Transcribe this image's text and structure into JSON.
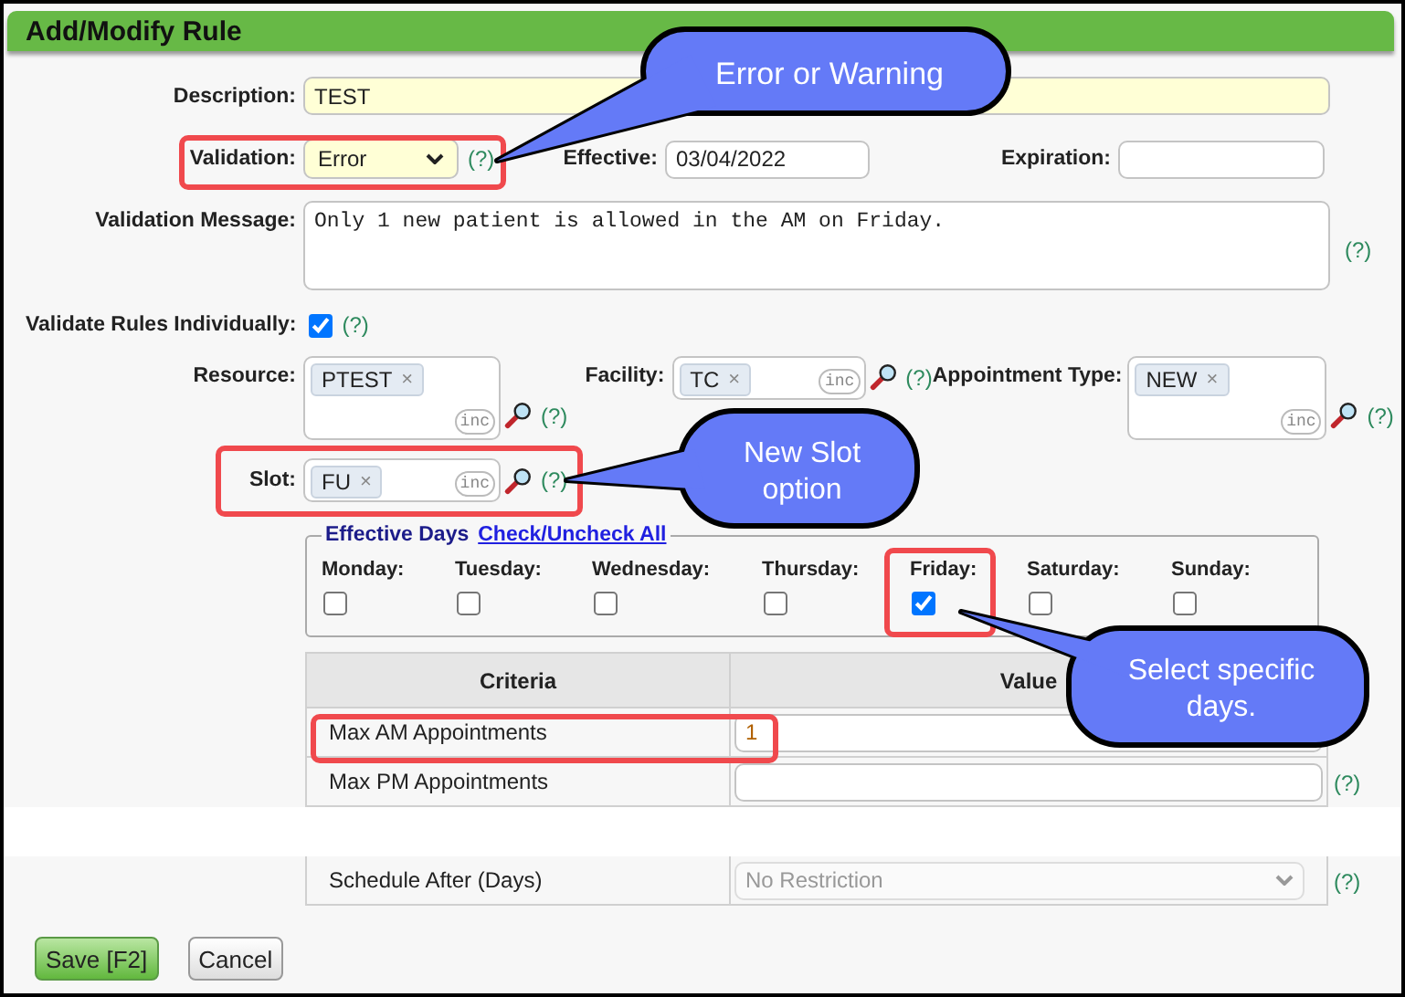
{
  "title": "Add/Modify Rule",
  "description": {
    "label": "Description:",
    "value": "TEST"
  },
  "validation": {
    "label": "Validation:",
    "value": "Error",
    "help": "(?)"
  },
  "effective": {
    "label": "Effective:",
    "value": "03/04/2022"
  },
  "expiration": {
    "label": "Expiration:"
  },
  "validation_message": {
    "label": "Validation Message:",
    "value": "Only 1 new patient is allowed in the AM on Friday.",
    "help": "(?)"
  },
  "validate_individually": {
    "label": "Validate Rules Individually:",
    "checked": true,
    "help": "(?)"
  },
  "pickers": [
    {
      "label": "Resource:",
      "tags": [
        {
          "text": "PTEST",
          "remove": "×"
        }
      ],
      "inc": "inc",
      "help": "(?)"
    },
    {
      "label": "Facility:",
      "tags": [
        {
          "text": "TC",
          "remove": "×"
        }
      ],
      "inc": "inc",
      "help": "(?)"
    },
    {
      "label": "Appointment Type:",
      "tags": [
        {
          "text": "NEW",
          "remove": "×"
        }
      ],
      "inc": "inc",
      "help": "(?)"
    }
  ],
  "slot": {
    "label": "Slot:",
    "tags": [
      {
        "text": "FU",
        "remove": "×"
      }
    ],
    "inc": "inc",
    "help": "(?)"
  },
  "effective_days": {
    "legend": "Effective Days",
    "link": "Check/Uncheck All",
    "days": [
      {
        "label": "Monday:",
        "checked": false
      },
      {
        "label": "Tuesday:",
        "checked": false
      },
      {
        "label": "Wednesday:",
        "checked": false
      },
      {
        "label": "Thursday:",
        "checked": false
      },
      {
        "label": "Friday:",
        "checked": true
      },
      {
        "label": "Saturday:",
        "checked": false
      },
      {
        "label": "Sunday:",
        "checked": false
      }
    ]
  },
  "criteria": {
    "columns": [
      "Criteria",
      "Value"
    ],
    "rows": [
      {
        "kind": "text",
        "label": "Max AM Appointments",
        "value": "1"
      },
      {
        "kind": "text",
        "label": "Max PM Appointments",
        "help": "(?)"
      },
      {
        "kind": "gap"
      },
      {
        "kind": "select",
        "label": "Schedule After (Days)",
        "value": "No Restriction",
        "disabled": true,
        "help": "(?)"
      }
    ]
  },
  "buttons": [
    {
      "label": "Save [F2]",
      "primary": true
    },
    {
      "label": "Cancel",
      "primary": false
    }
  ],
  "callouts": [
    {
      "text": "Error or Warning"
    },
    {
      "text": "New Slot option"
    },
    {
      "text": "Select specific days."
    }
  ]
}
